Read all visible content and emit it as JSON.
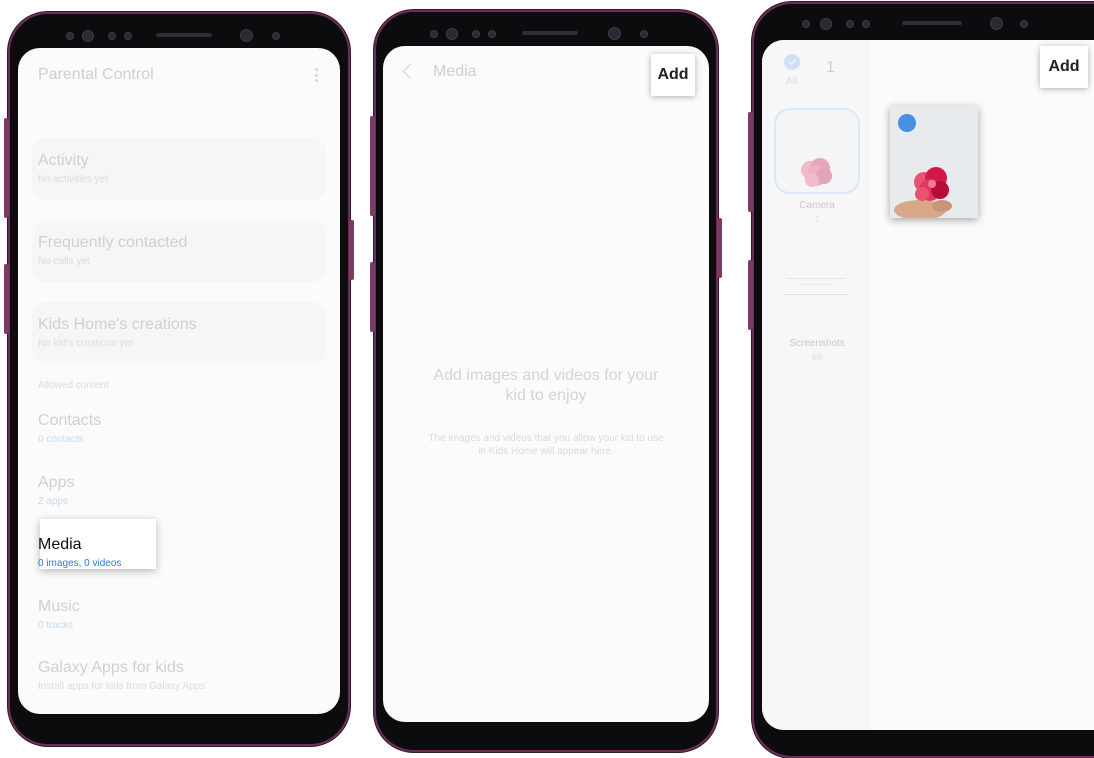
{
  "screen1": {
    "title": "Parental Control",
    "menu_icon": "more-vertical-icon",
    "activity": {
      "title": "Activity",
      "sub": "No activities yet"
    },
    "frequent": {
      "title": "Frequently contacted",
      "sub": "No calls yet"
    },
    "creations": {
      "title": "Kids Home's creations",
      "sub": "No kid's creations yet"
    },
    "allowed_header": "Allowed content",
    "contacts": {
      "title": "Contacts",
      "sub": "0 contacts"
    },
    "apps": {
      "title": "Apps",
      "sub": "2 apps"
    },
    "media": {
      "title": "Media",
      "sub": "0 images, 0 videos"
    },
    "music": {
      "title": "Music",
      "sub": "0 tracks"
    },
    "galaxy": {
      "title": "Galaxy Apps for kids",
      "sub": "Install apps for kids from Galaxy Apps"
    }
  },
  "screen2": {
    "back_icon": "chevron-left-icon",
    "title": "Media",
    "add": "Add",
    "empty_title": "Add images and videos for your kid to enjoy",
    "empty_sub": "The images and videos that you allow your kid to use in Kids Home will appear here."
  },
  "screen3": {
    "all_label": "All",
    "count": "1",
    "add": "Add",
    "albums": [
      {
        "name": "Camera",
        "count": "1"
      },
      {
        "name": "Screenshots",
        "count": "69"
      }
    ]
  },
  "colors": {
    "frame": "#6b2f55",
    "accent": "#4a90e2",
    "link": "#c6daf0",
    "flower": "#d11a4a"
  }
}
